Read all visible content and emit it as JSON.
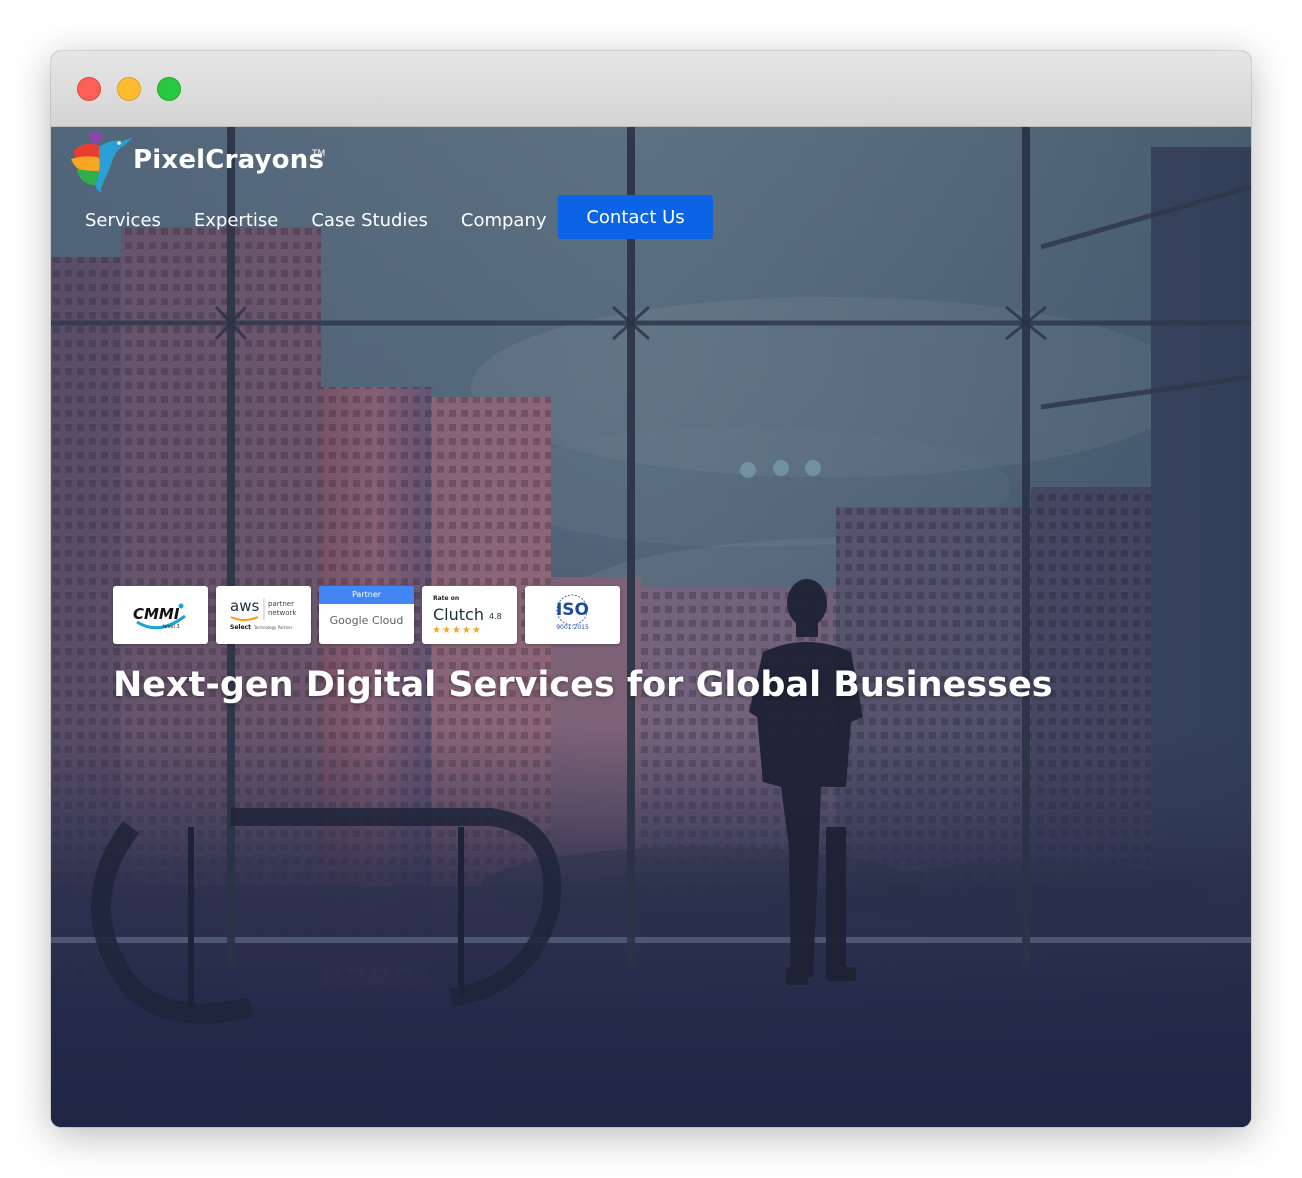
{
  "brand": {
    "name": "PixelCrayons",
    "tm": "TM"
  },
  "nav": {
    "items": [
      {
        "label": "Services"
      },
      {
        "label": "Expertise"
      },
      {
        "label": "Case Studies"
      },
      {
        "label": "Company"
      }
    ],
    "cta_label": "Contact Us"
  },
  "badges": {
    "cmmi": {
      "title": "CMMI",
      "sub": "level 3"
    },
    "aws": {
      "line1": "aws",
      "line2": "partner",
      "line3": "network",
      "line4": "Select",
      "line5": "Technology Partner"
    },
    "google": {
      "header": "Partner",
      "label": "Google Cloud"
    },
    "clutch": {
      "top": "Rate on",
      "name": "Clutch",
      "rating": "4.8"
    },
    "iso": {
      "title": "ISO",
      "sub": "9001:2015"
    }
  },
  "hero": {
    "title": "Next-gen Digital Services for Global Businesses"
  },
  "colors": {
    "cta": "#0b63e5",
    "google_header": "#4285f4",
    "clutch_star": "#f6a623",
    "iso_blue": "#1c4b9a"
  }
}
